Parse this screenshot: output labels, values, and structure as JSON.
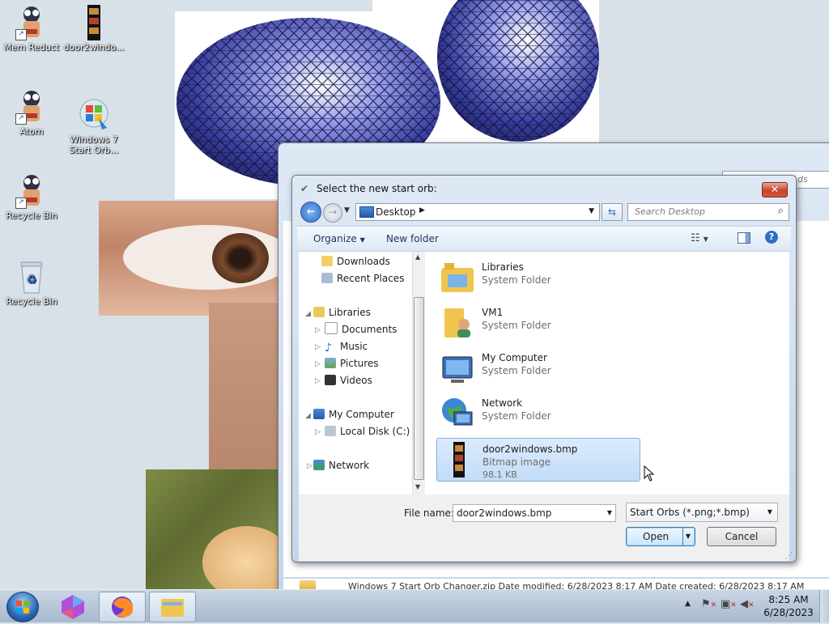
{
  "desktop": {
    "icons": [
      {
        "label": "Mem Reduct",
        "icon": "mem-reduct-icon"
      },
      {
        "label": "door2windo...",
        "icon": "bitmap-file-icon"
      },
      {
        "label": "Atom",
        "icon": "atom-icon"
      },
      {
        "label": "Windows 7 Start Orb...",
        "icon": "windows-orb-icon"
      },
      {
        "label": "Recycle Bin",
        "icon": "mem-reduct-icon"
      },
      {
        "label": "Recycle Bin",
        "icon": "recycle-bin-icon"
      }
    ]
  },
  "background_window": {
    "search_placeholder": "ds",
    "status_line": "Windows 7 Start Orb Changer.zip  Date modified: 6/28/2023 8:17 AM  Date created: 6/28/2023 8:17 AM"
  },
  "dialog": {
    "title": "Select the new start orb:",
    "close": "✕",
    "address": "Desktop",
    "search_placeholder": "Search Desktop",
    "toolbar": {
      "organize": "Organize",
      "new_folder": "New folder"
    },
    "nav": {
      "downloads": "Downloads",
      "recent_places": "Recent Places",
      "libraries": "Libraries",
      "documents": "Documents",
      "music": "Music",
      "pictures": "Pictures",
      "videos": "Videos",
      "my_computer": "My Computer",
      "local_disk": "Local Disk (C:)",
      "network": "Network"
    },
    "items": [
      {
        "name": "Libraries",
        "type": "System Folder"
      },
      {
        "name": "VM1",
        "type": "System Folder"
      },
      {
        "name": "My Computer",
        "type": "System Folder"
      },
      {
        "name": "Network",
        "type": "System Folder"
      },
      {
        "name": "door2windows.bmp",
        "type": "Bitmap image",
        "size": "98.1 KB"
      }
    ],
    "file_name_label": "File name:",
    "file_name_value": "door2windows.bmp",
    "file_type_value": "Start Orbs (*.png;*.bmp)",
    "open": "Open",
    "cancel": "Cancel"
  },
  "taskbar": {
    "time": "8:25 AM",
    "date": "6/28/2023"
  },
  "colors": {
    "accent": "#3c7fb1",
    "selection": "#cce3fa",
    "close": "#c8452b"
  }
}
